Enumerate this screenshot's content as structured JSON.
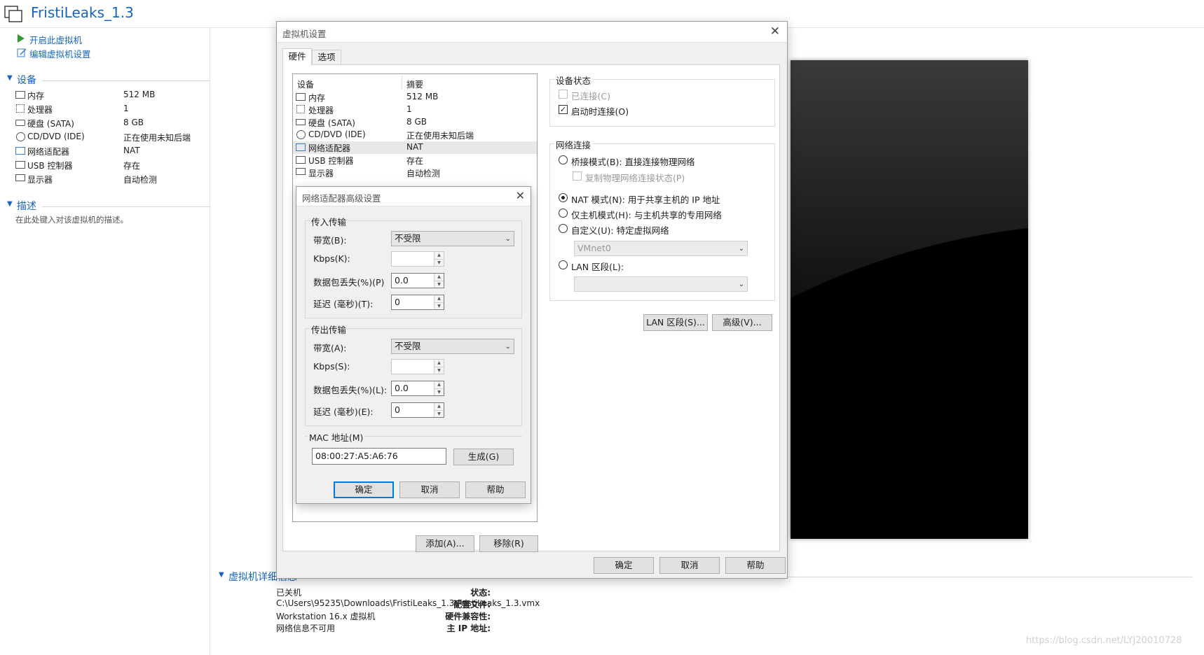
{
  "app": {
    "title": "FristiLeaks_1.3",
    "watermark": "https://blog.csdn.net/LYJ20010728"
  },
  "actions": {
    "power_on": "开启此虚拟机",
    "edit_settings": "编辑虚拟机设置"
  },
  "devices_section": {
    "title": "设备",
    "items": [
      {
        "name": "内存",
        "value": "512 MB",
        "icon": "memory-icon"
      },
      {
        "name": "处理器",
        "value": "1",
        "icon": "cpu-icon"
      },
      {
        "name": "硬盘 (SATA)",
        "value": "8 GB",
        "icon": "disk-icon"
      },
      {
        "name": "CD/DVD (IDE)",
        "value": "正在使用未知后端",
        "icon": "cd-icon"
      },
      {
        "name": "网络适配器",
        "value": "NAT",
        "icon": "network-icon"
      },
      {
        "name": "USB 控制器",
        "value": "存在",
        "icon": "usb-icon"
      },
      {
        "name": "显示器",
        "value": "自动检测",
        "icon": "monitor-icon"
      }
    ]
  },
  "description_section": {
    "title": "描述",
    "placeholder": "在此处键入对该虚拟机的描述。"
  },
  "details": {
    "title": "虚拟机详细信息",
    "rows": [
      {
        "label": "状态:",
        "value": "已关机"
      },
      {
        "label": "配置文件:",
        "value": "C:\\Users\\95235\\Downloads\\FristiLeaks_1.3\\FristiLeaks_1.3.vmx"
      },
      {
        "label": "硬件兼容性:",
        "value": "Workstation 16.x 虚拟机"
      },
      {
        "label": "主 IP 地址:",
        "value": "网络信息不可用"
      }
    ]
  },
  "settings": {
    "title": "虚拟机设置",
    "tabs": [
      "硬件",
      "选项"
    ],
    "col_device": "设备",
    "col_summary": "摘要",
    "devices": [
      {
        "name": "内存",
        "summary": "512 MB"
      },
      {
        "name": "处理器",
        "summary": "1"
      },
      {
        "name": "硬盘 (SATA)",
        "summary": "8 GB"
      },
      {
        "name": "CD/DVD (IDE)",
        "summary": "正在使用未知后端"
      },
      {
        "name": "网络适配器",
        "summary": "NAT"
      },
      {
        "name": "USB 控制器",
        "summary": "存在"
      },
      {
        "name": "显示器",
        "summary": "自动检测"
      }
    ],
    "device_status": {
      "title": "设备状态",
      "connected": "已连接(C)",
      "connect_on_power": "启动时连接(O)"
    },
    "network": {
      "title": "网络连接",
      "bridged": "桥接模式(B): 直接连接物理网络",
      "replicate": "复制物理网络连接状态(P)",
      "nat": "NAT 模式(N): 用于共享主机的 IP 地址",
      "host_only": "仅主机模式(H): 与主机共享的专用网络",
      "custom": "自定义(U): 特定虚拟网络",
      "vmnet": "VMnet0",
      "lan": "LAN 区段(L):"
    },
    "lan_button": "LAN 区段(S)...",
    "advanced_button": "高级(V)...",
    "add_button": "添加(A)...",
    "remove_button": "移除(R)",
    "ok": "确定",
    "cancel": "取消",
    "help": "帮助"
  },
  "advanced": {
    "title": "网络适配器高级设置",
    "incoming": {
      "title": "传入传输",
      "bandwidth_label": "带宽(B):",
      "bandwidth": "不受限",
      "kbps_label": "Kbps(K):",
      "loss_label": "数据包丢失(%)(P)",
      "loss": "0.0",
      "latency_label": "延迟 (毫秒)(T):",
      "latency": "0"
    },
    "outgoing": {
      "title": "传出传输",
      "bandwidth_label": "带宽(A):",
      "bandwidth": "不受限",
      "kbps_label": "Kbps(S):",
      "loss_label": "数据包丢失(%)(L):",
      "loss": "0.0",
      "latency_label": "延迟 (毫秒)(E):",
      "latency": "0"
    },
    "mac": {
      "title": "MAC 地址(M)",
      "value": "08:00:27:A5:A6:76",
      "generate": "生成(G)"
    },
    "ok": "确定",
    "cancel": "取消",
    "help": "帮助"
  }
}
